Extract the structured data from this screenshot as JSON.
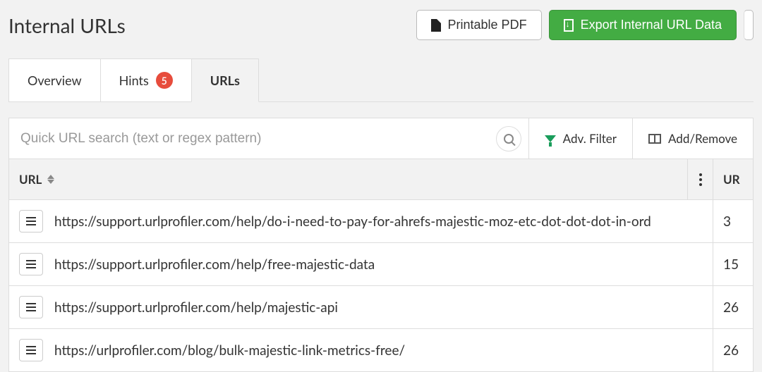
{
  "header": {
    "title": "Internal URLs",
    "pdf_label": "Printable PDF",
    "export_label": "Export Internal URL Data"
  },
  "tabs": {
    "overview_label": "Overview",
    "hints_label": "Hints",
    "hints_count": "5",
    "urls_label": "URLs",
    "active": "urls"
  },
  "toolbar": {
    "search_placeholder": "Quick URL search (text or regex pattern)",
    "search_value": "",
    "adv_filter_label": "Adv. Filter",
    "add_remove_label": "Add/Remove"
  },
  "table": {
    "columns": {
      "url_label": "URL",
      "ur_label": "UR"
    },
    "rows": [
      {
        "url": "https://support.urlprofiler.com/help/do-i-need-to-pay-for-ahrefs-majestic-moz-etc-dot-dot-dot-in-ord",
        "ur": "3"
      },
      {
        "url": "https://support.urlprofiler.com/help/free-majestic-data",
        "ur": "15"
      },
      {
        "url": "https://support.urlprofiler.com/help/majestic-api",
        "ur": "26"
      },
      {
        "url": "https://urlprofiler.com/blog/bulk-majestic-link-metrics-free/",
        "ur": "26"
      }
    ]
  }
}
